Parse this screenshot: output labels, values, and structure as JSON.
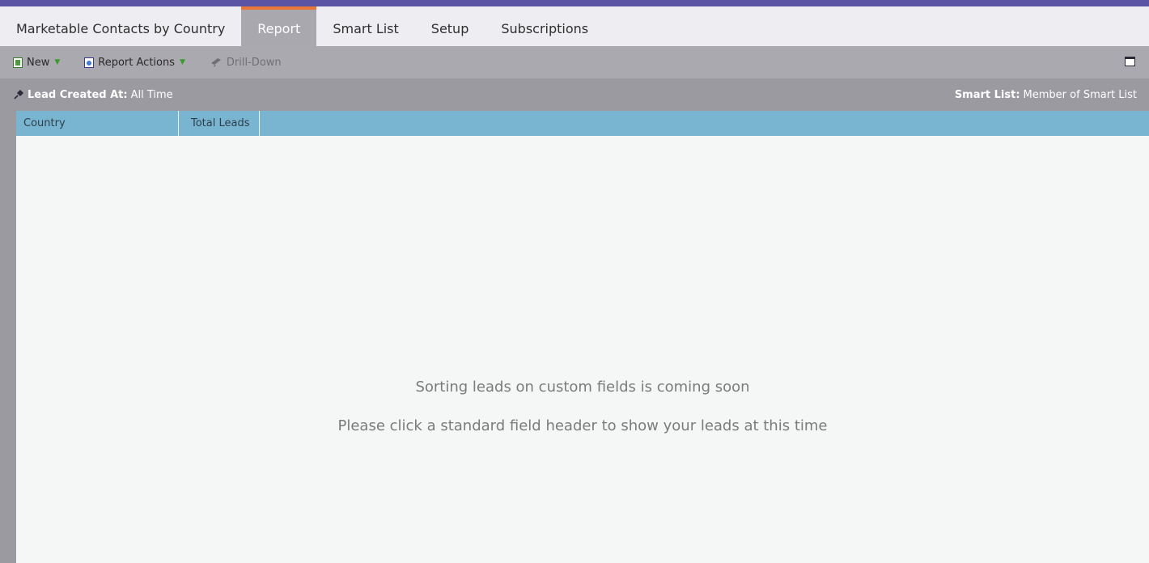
{
  "tabs": [
    {
      "label": "Marketable Contacts by Country"
    },
    {
      "label": "Report"
    },
    {
      "label": "Smart List"
    },
    {
      "label": "Setup"
    },
    {
      "label": "Subscriptions"
    }
  ],
  "toolbar": {
    "new_label": "New",
    "report_actions_label": "Report Actions",
    "drill_down_label": "Drill-Down"
  },
  "filters": {
    "left_label": "Lead Created At:",
    "left_value": "All Time",
    "right_label": "Smart List:",
    "right_value": "Member of Smart List"
  },
  "grid": {
    "columns": [
      "Country",
      "Total Leads"
    ]
  },
  "messages": {
    "line1": "Sorting leads on custom fields is coming soon",
    "line2": "Please click a standard field header to show your leads at this time"
  },
  "colors": {
    "brand_bar": "#5b53a3",
    "active_tab_accent": "#e8773a",
    "grid_header": "#79b4d0"
  },
  "icons": [
    "new-report-icon",
    "report-actions-icon",
    "drill-down-icon",
    "filter-pin-icon",
    "window-maximize-icon",
    "dropdown-caret-icon"
  ]
}
